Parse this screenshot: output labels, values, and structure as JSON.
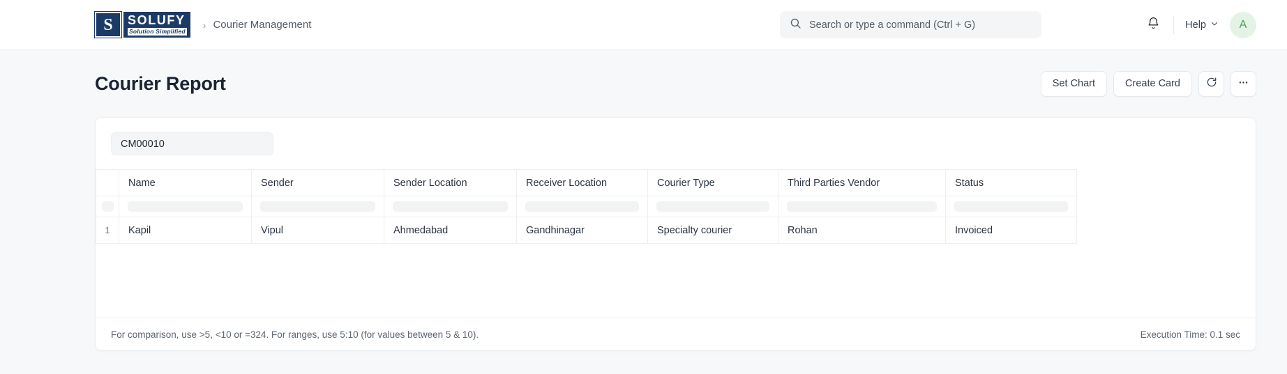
{
  "navbar": {
    "logo": {
      "mark_letter": "S",
      "title": "SOLUFY",
      "tagline": "Solution Simplified"
    },
    "breadcrumb_separator": "›",
    "breadcrumb": "Courier Management",
    "search": {
      "placeholder": "Search or type a command (Ctrl + G)",
      "icon": "search-icon"
    },
    "notifications_icon": "bell-icon",
    "help": {
      "label": "Help",
      "chevron": "chevron-down-icon"
    },
    "avatar_initial": "A"
  },
  "page": {
    "title": "Courier Report",
    "actions": {
      "set_chart": "Set Chart",
      "create_card": "Create Card",
      "refresh_icon": "refresh-icon",
      "more_icon": "ellipsis-icon"
    }
  },
  "filter": {
    "value": "CM00010"
  },
  "table": {
    "index_header": "",
    "columns": [
      "Name",
      "Sender",
      "Sender Location",
      "Receiver Location",
      "Courier Type",
      "Third Parties Vendor",
      "Status"
    ],
    "rows": [
      {
        "index": "1",
        "cells": [
          "Kapil",
          "Vipul",
          "Ahmedabad",
          "Gandhinagar",
          "Specialty courier",
          "Rohan",
          "Invoiced"
        ]
      }
    ]
  },
  "footer": {
    "hint": "For comparison, use >5, <10 or =324. For ranges, use 5:10 (for values between 5 & 10).",
    "execution_time": "Execution Time: 0.1 sec"
  },
  "colors": {
    "brand_navy": "#1b3a66",
    "page_bg": "#f7f8f9",
    "avatar_bg": "#e3f3e5",
    "avatar_fg": "#4d9e5b",
    "border": "#ebeef0"
  }
}
